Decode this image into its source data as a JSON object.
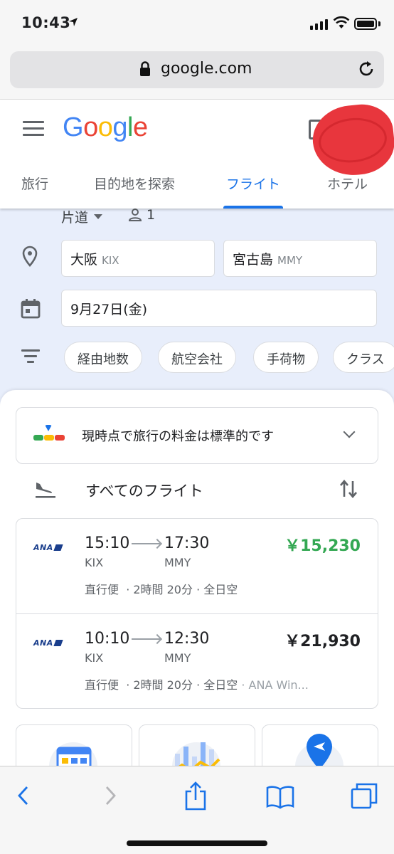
{
  "status_bar": {
    "time": "10:43"
  },
  "browser": {
    "url": "google.com"
  },
  "logo": [
    "G",
    "o",
    "o",
    "g",
    "l",
    "e"
  ],
  "logo_colors": [
    "#4285f4",
    "#ea4335",
    "#fbbc05",
    "#4285f4",
    "#34a853",
    "#ea4335"
  ],
  "tabs": [
    {
      "label": "旅行"
    },
    {
      "label": "目的地を探索"
    },
    {
      "label": "フライト"
    },
    {
      "label": "ホテル"
    }
  ],
  "search": {
    "trip_type": "片道",
    "passengers": "1",
    "origin": {
      "city": "大阪",
      "code": "KIX"
    },
    "destination": {
      "city": "宮古島",
      "code": "MMY"
    },
    "date": "9月27日(金)",
    "filters": [
      "経由地数",
      "航空会社",
      "手荷物",
      "クラス"
    ]
  },
  "price_insight": "現時点で旅行の料金は標準的です",
  "all_flights_label": "すべてのフライト",
  "flights": [
    {
      "airline_logo": "ANA",
      "depart": "15:10",
      "arrive": "17:30",
      "from": "KIX",
      "to": "MMY",
      "stops": "直行便",
      "duration": "· 2時間 20分",
      "carrier": "· 全日空",
      "extra": "",
      "price": "￥15,230"
    },
    {
      "airline_logo": "ANA",
      "depart": "10:10",
      "arrive": "12:30",
      "from": "KIX",
      "to": "MMY",
      "stops": "直行便",
      "duration": "· 2時間 20分",
      "carrier": "· 全日空",
      "extra": "· ANA Win...",
      "price": "￥21,930"
    }
  ],
  "colors": {
    "accent": "#1a73e8",
    "low_price": "#34a853",
    "search_bg": "#e8eefb"
  }
}
